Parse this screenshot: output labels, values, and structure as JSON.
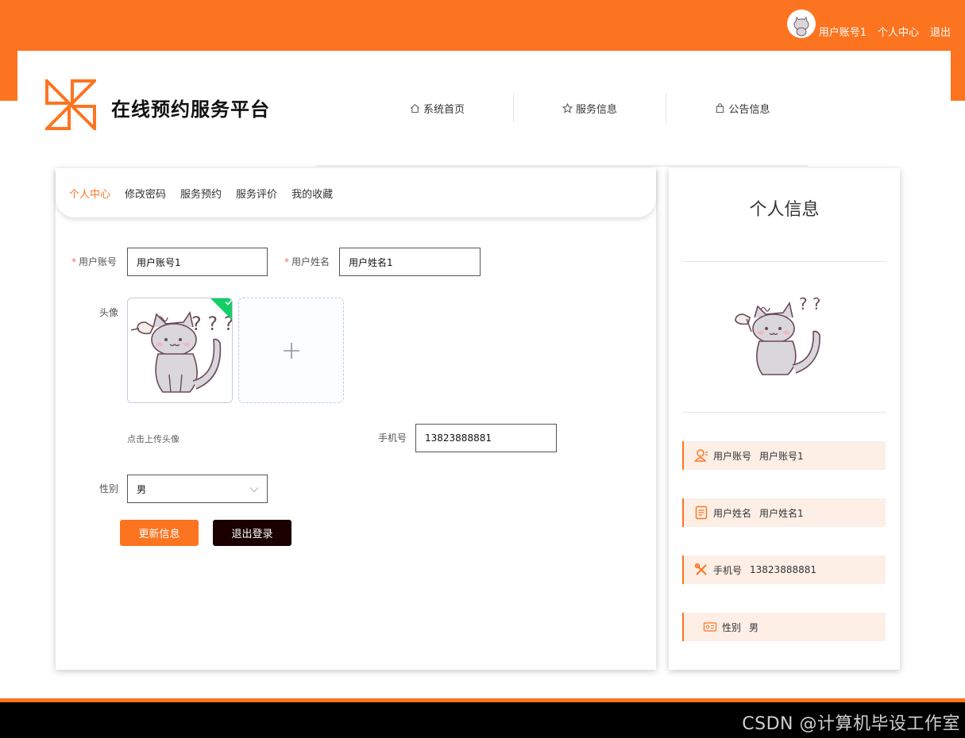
{
  "topbar": {
    "username": "用户账号1",
    "center_link": "个人中心",
    "logout_link": "退出"
  },
  "site": {
    "title": "在线预约服务平台"
  },
  "nav": {
    "items": [
      {
        "label": "系统首页",
        "icon": "home-icon"
      },
      {
        "label": "服务信息",
        "icon": "star-icon"
      },
      {
        "label": "公告信息",
        "icon": "bag-icon"
      }
    ]
  },
  "tabs": {
    "items": [
      "个人中心",
      "修改密码",
      "服务预约",
      "服务评价",
      "我的收藏"
    ],
    "active": 0
  },
  "form": {
    "account_label": "用户账号",
    "account_value": "用户账号1",
    "name_label": "用户姓名",
    "name_value": "用户姓名1",
    "avatar_label": "头像",
    "upload_tip": "点击上传头像",
    "phone_label": "手机号",
    "phone_value": "13823888881",
    "gender_label": "性别",
    "gender_value": "男",
    "update_button": "更新信息",
    "logout_button": "退出登录"
  },
  "side": {
    "title": "个人信息",
    "rows": [
      {
        "label": "用户账号",
        "value": "用户账号1",
        "icon": "user-icon"
      },
      {
        "label": "用户姓名",
        "value": "用户姓名1",
        "icon": "document-icon"
      },
      {
        "label": "手机号",
        "value": "13823888881",
        "icon": "tools-icon"
      },
      {
        "label": "性别",
        "value": "男",
        "icon": "id-card-icon"
      }
    ]
  },
  "watermark": "CSDN @计算机毕设工作室",
  "colors": {
    "accent": "#fd7420",
    "dark_button": "#1b0000",
    "row_bg": "#fdeee6",
    "success": "#13ce66"
  }
}
